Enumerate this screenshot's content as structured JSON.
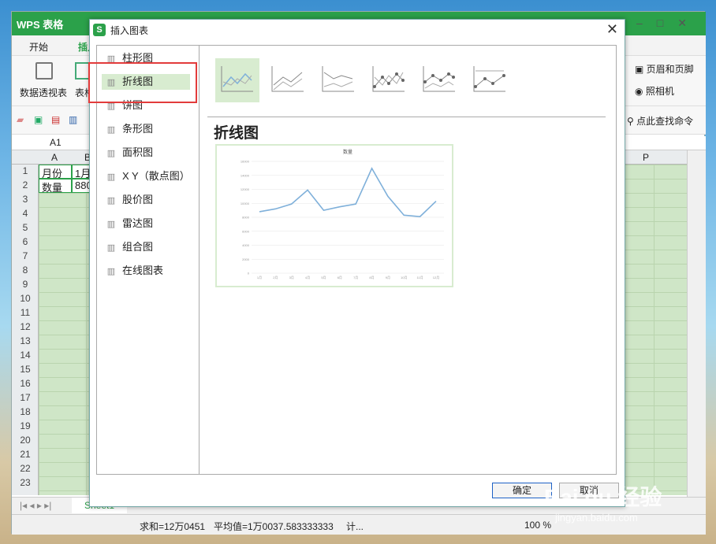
{
  "app": {
    "title": "WPS 表格",
    "ribbon_tabs": [
      "开始",
      "插入"
    ],
    "ribbon": {
      "pivot": "数据透视表",
      "table": "表格",
      "header_footer": "页眉和页脚",
      "camera": "照相机",
      "find_command": "点此查找命令"
    },
    "cell_ref": "A1",
    "columns": [
      "A",
      "B",
      "P"
    ],
    "rows": [
      "1",
      "2",
      "3",
      "4",
      "5",
      "6",
      "7",
      "8",
      "9",
      "10",
      "11",
      "12",
      "13",
      "14",
      "15",
      "16",
      "17",
      "18",
      "19",
      "20",
      "21",
      "22",
      "23"
    ],
    "cells": {
      "a1": "月份",
      "b1": "1月",
      "a2": "数量",
      "b2": "880"
    },
    "sheet_tab": "Sheet1",
    "status": {
      "sum": "求和=12万0451",
      "avg": "平均值=1万0037.583333333",
      "more": "计...",
      "zoom": "100 %"
    }
  },
  "dialog": {
    "title": "插入图表",
    "close": "✕",
    "categories": [
      {
        "label": "柱形图",
        "icon": "column-chart-icon"
      },
      {
        "label": "折线图",
        "icon": "line-chart-icon"
      },
      {
        "label": "饼图",
        "icon": "pie-chart-icon"
      },
      {
        "label": "条形图",
        "icon": "bar-chart-icon"
      },
      {
        "label": "面积图",
        "icon": "area-chart-icon"
      },
      {
        "label": "X Y（散点图）",
        "icon": "scatter-chart-icon"
      },
      {
        "label": "股价图",
        "icon": "stock-chart-icon"
      },
      {
        "label": "雷达图",
        "icon": "radar-chart-icon"
      },
      {
        "label": "组合图",
        "icon": "combo-chart-icon"
      },
      {
        "label": "在线图表",
        "icon": "online-chart-icon"
      }
    ],
    "selected_category": "折线图",
    "chart_heading": "折线图",
    "ok": "确定",
    "cancel": "取消"
  },
  "chart_data": {
    "type": "line",
    "title": "数量",
    "categories": [
      "1月",
      "2月",
      "3月",
      "4月",
      "5月",
      "6月",
      "7月",
      "8月",
      "9月",
      "10月",
      "11月",
      "12月"
    ],
    "series": [
      {
        "values": [
          8800,
          9200,
          9900,
          11900,
          9000,
          9500,
          9900,
          15000,
          11000,
          8300,
          8100,
          10300
        ]
      }
    ],
    "ylim": [
      0,
      16000
    ],
    "yticks": [
      "0",
      "2000",
      "4000",
      "6000",
      "8000",
      "10000",
      "12000",
      "14000",
      "16000"
    ],
    "grid": true,
    "color": "#7fb0da"
  },
  "watermark": {
    "main": "Bai du 经验",
    "sub": "jingyan.baidu.com"
  }
}
